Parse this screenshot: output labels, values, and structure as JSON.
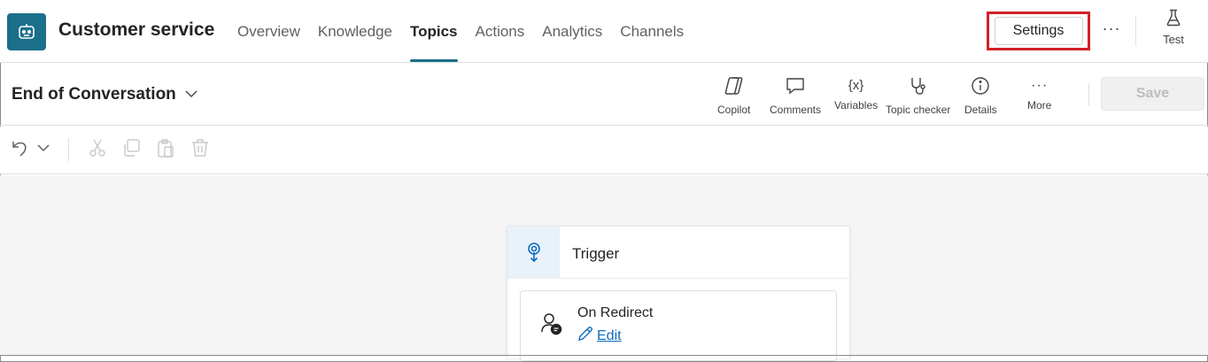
{
  "header": {
    "title": "Customer service",
    "avatar_icon": "bot-icon",
    "tabs": [
      {
        "label": "Overview",
        "active": false
      },
      {
        "label": "Knowledge",
        "active": false
      },
      {
        "label": "Topics",
        "active": true
      },
      {
        "label": "Actions",
        "active": false
      },
      {
        "label": "Analytics",
        "active": false
      },
      {
        "label": "Channels",
        "active": false
      }
    ],
    "settings_label": "Settings",
    "more_label": "···",
    "test_label": "Test",
    "accent_color": "#1b6f8a",
    "highlight_color": "#d32127"
  },
  "topic": {
    "title": "End of Conversation",
    "tools": [
      {
        "label": "Copilot",
        "icon": "copilot-icon"
      },
      {
        "label": "Comments",
        "icon": "comment-icon"
      },
      {
        "label": "Variables",
        "icon": "variables-icon"
      },
      {
        "label": "Topic checker",
        "icon": "stethoscope-icon"
      },
      {
        "label": "Details",
        "icon": "info-icon"
      },
      {
        "label": "More",
        "icon": "more-icon"
      }
    ],
    "variables_glyph": "{x}",
    "more_glyph": "···",
    "save_label": "Save"
  },
  "toolbar": {
    "icons": [
      "undo-icon",
      "chevron-down-icon",
      "cut-icon",
      "copy-icon",
      "paste-icon",
      "delete-icon"
    ]
  },
  "canvas": {
    "trigger_label": "Trigger",
    "node_title": "On Redirect",
    "edit_label": "Edit",
    "link_color": "#0f6cbd"
  }
}
